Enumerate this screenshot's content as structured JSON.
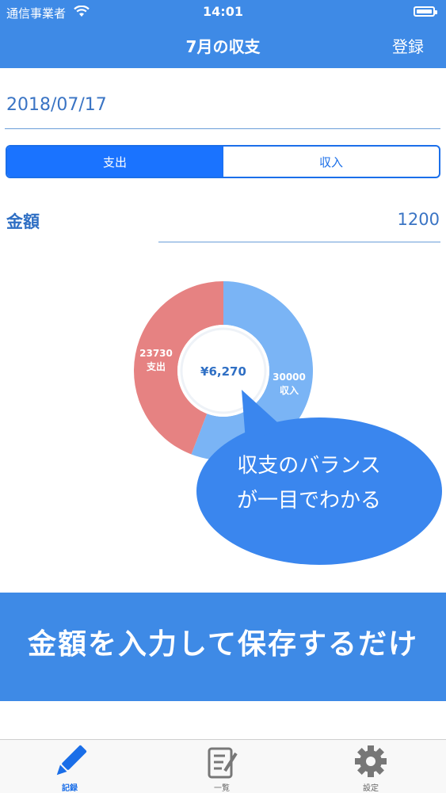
{
  "status_bar": {
    "carrier": "通信事業者",
    "time": "14:01"
  },
  "nav": {
    "title": "7月の収支",
    "right_button": "登録"
  },
  "form": {
    "date": "2018/07/17",
    "segments": [
      "支出",
      "収入"
    ],
    "selected_segment": "支出",
    "amount_label": "金額",
    "amount_value": "1200"
  },
  "chart_data": {
    "type": "pie",
    "center_label": "¥6,270",
    "slices": [
      {
        "name": "支出",
        "value": 23730,
        "label": "23730",
        "color": "#e68282"
      },
      {
        "name": "収入",
        "value": 30000,
        "label": "30000",
        "color": "#7ab4f5"
      }
    ]
  },
  "callout": {
    "line1": "収支のバランス",
    "line2": "が一目でわかる"
  },
  "banner": {
    "text": "金額を入力して保存するだけ"
  },
  "tabbar": {
    "items": [
      {
        "label": "記録",
        "icon": "pencil-icon",
        "active": true
      },
      {
        "label": "一覧",
        "icon": "list-icon",
        "active": false
      },
      {
        "label": "設定",
        "icon": "gear-icon",
        "active": false
      }
    ]
  },
  "colors": {
    "brand": "#3e8ae6",
    "segment_active": "#1a73ff",
    "expense": "#e68282",
    "income": "#7ab4f5"
  }
}
